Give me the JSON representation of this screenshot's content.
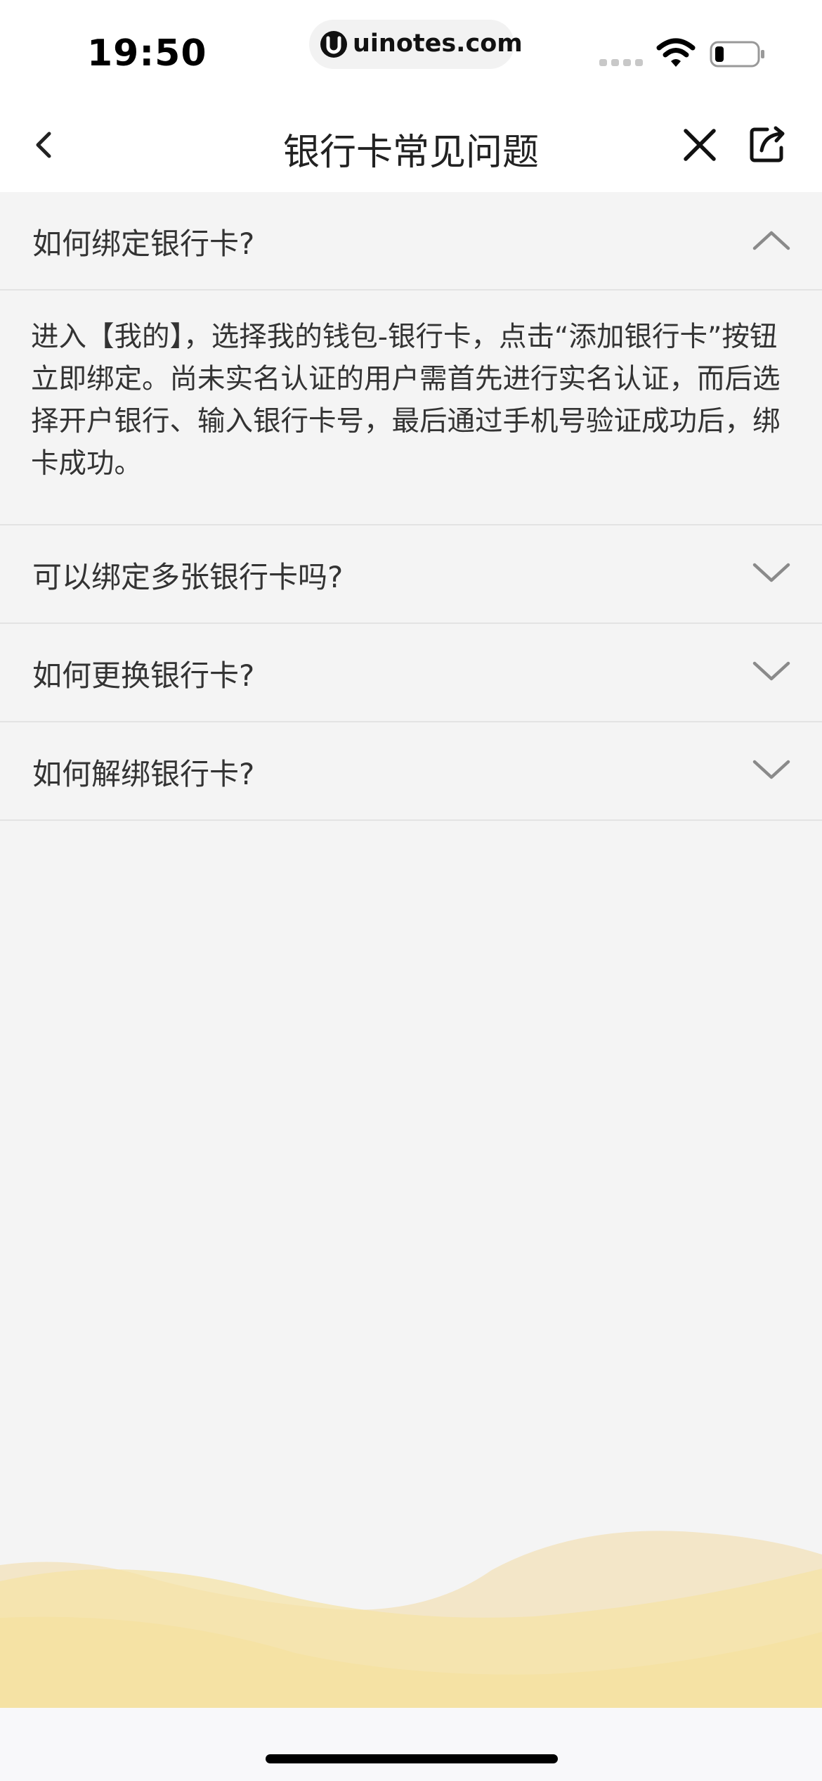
{
  "status_bar": {
    "time": "19:50",
    "url": "uinotes.com"
  },
  "nav": {
    "title": "银行卡常见问题",
    "back_icon": "chevron-left-icon",
    "close_icon": "close-icon",
    "share_icon": "share-icon"
  },
  "faq": {
    "items": [
      {
        "question": "如何绑定银行卡?",
        "expanded": true,
        "answer": "进入【我的】，选择我的钱包-银行卡，点击“添加银行卡”按钮立即绑定。尚未实名认证的用户需首先进行实名认证，而后选择开户银行、输入银行卡号，最后通过手机号验证成功后，绑卡成功。"
      },
      {
        "question": "可以绑定多张银行卡吗?",
        "expanded": false
      },
      {
        "question": "如何更换银行卡?",
        "expanded": false
      },
      {
        "question": "如何解绑银行卡?",
        "expanded": false
      }
    ]
  },
  "colors": {
    "background": "#f4f4f4",
    "divider": "#e3e3e3",
    "wave_light": "#f3e6c8",
    "wave_main": "#f5e2a4"
  }
}
